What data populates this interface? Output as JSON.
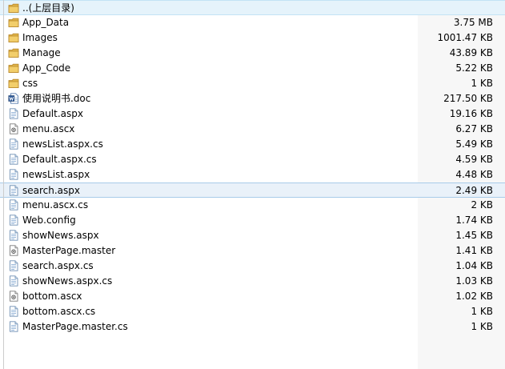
{
  "files": [
    {
      "name": "..(上层目录)",
      "size": "",
      "icon": "folder-icon",
      "state": "selected"
    },
    {
      "name": "App_Data",
      "size": "3.75 MB",
      "icon": "folder-icon",
      "state": ""
    },
    {
      "name": "Images",
      "size": "1001.47 KB",
      "icon": "folder-icon",
      "state": ""
    },
    {
      "name": "Manage",
      "size": "43.89 KB",
      "icon": "folder-icon",
      "state": ""
    },
    {
      "name": "App_Code",
      "size": "5.22 KB",
      "icon": "folder-icon",
      "state": ""
    },
    {
      "name": "css",
      "size": "1 KB",
      "icon": "folder-icon",
      "state": ""
    },
    {
      "name": "使用说明书.doc",
      "size": "217.50 KB",
      "icon": "word-document-icon",
      "state": ""
    },
    {
      "name": "Default.aspx",
      "size": "19.16 KB",
      "icon": "document-icon",
      "state": ""
    },
    {
      "name": "menu.ascx",
      "size": "6.27 KB",
      "icon": "settings-document-icon",
      "state": ""
    },
    {
      "name": "newsList.aspx.cs",
      "size": "5.49 KB",
      "icon": "document-icon",
      "state": ""
    },
    {
      "name": "Default.aspx.cs",
      "size": "4.59 KB",
      "icon": "document-icon",
      "state": ""
    },
    {
      "name": "newsList.aspx",
      "size": "4.48 KB",
      "icon": "document-icon",
      "state": ""
    },
    {
      "name": "search.aspx",
      "size": "2.49 KB",
      "icon": "document-icon",
      "state": "highlight"
    },
    {
      "name": "menu.ascx.cs",
      "size": "2 KB",
      "icon": "document-icon",
      "state": ""
    },
    {
      "name": "Web.config",
      "size": "1.74 KB",
      "icon": "document-icon",
      "state": ""
    },
    {
      "name": "showNews.aspx",
      "size": "1.45 KB",
      "icon": "document-icon",
      "state": ""
    },
    {
      "name": "MasterPage.master",
      "size": "1.41 KB",
      "icon": "settings-document-icon",
      "state": ""
    },
    {
      "name": "search.aspx.cs",
      "size": "1.04 KB",
      "icon": "document-icon",
      "state": ""
    },
    {
      "name": "showNews.aspx.cs",
      "size": "1.03 KB",
      "icon": "document-icon",
      "state": ""
    },
    {
      "name": "bottom.ascx",
      "size": "1.02 KB",
      "icon": "settings-document-icon",
      "state": ""
    },
    {
      "name": "bottom.ascx.cs",
      "size": "1 KB",
      "icon": "document-icon",
      "state": ""
    },
    {
      "name": "MasterPage.master.cs",
      "size": "1 KB",
      "icon": "document-icon",
      "state": ""
    }
  ]
}
